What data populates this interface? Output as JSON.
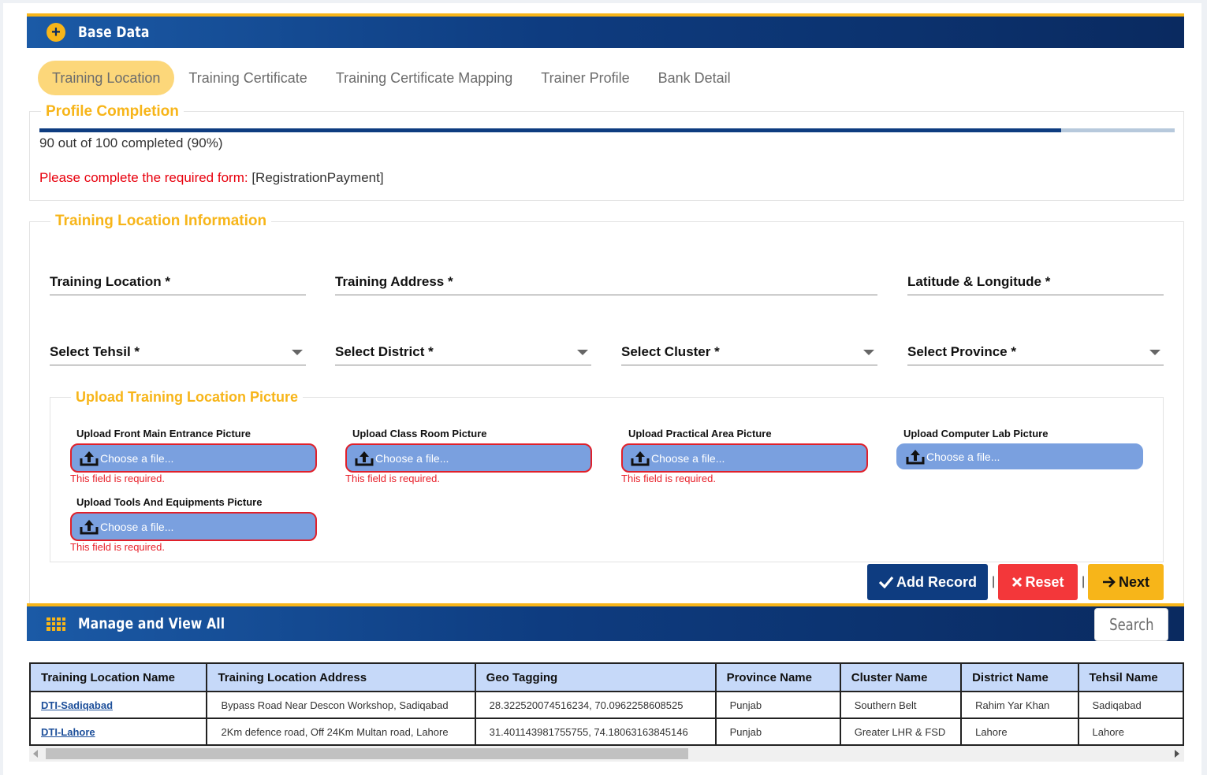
{
  "base_header": {
    "title": "Base Data"
  },
  "tabs": [
    {
      "label": "Training Location",
      "active": true
    },
    {
      "label": "Training Certificate"
    },
    {
      "label": "Training Certificate Mapping"
    },
    {
      "label": "Trainer Profile"
    },
    {
      "label": "Bank Detail"
    }
  ],
  "profile": {
    "legend": "Profile Completion",
    "progress_percent": 90,
    "progress_text": "90 out of 100 completed (90%)",
    "required_prefix": "Please complete the required form:",
    "required_forms": "[RegistrationPayment]"
  },
  "location_info": {
    "legend": "Training Location Information",
    "fields": {
      "training_location": "Training Location *",
      "training_address": "Training Address *",
      "lat_long": "Latitude & Longitude *",
      "tehsil": "Select Tehsil *",
      "district": "Select District *",
      "cluster": "Select Cluster *",
      "province": "Select Province *"
    }
  },
  "upload": {
    "legend": "Upload Training Location Picture",
    "choose_text": "Choose a file...",
    "error_text": "This field is required.",
    "items": {
      "front": "Upload Front Main Entrance Picture",
      "classroom": "Upload Class Room Picture",
      "practical": "Upload Practical Area Picture",
      "computer_lab": "Upload Computer Lab Picture",
      "tools": "Upload Tools And Equipments Picture"
    }
  },
  "actions": {
    "add_record": "Add Record",
    "reset": "Reset",
    "next": "Next",
    "separator": "|"
  },
  "manage_header": {
    "title": "Manage and View All",
    "search_label": "Search"
  },
  "table": {
    "columns": [
      "Training Location Name",
      "Training Location Address",
      "Geo Tagging",
      "Province Name",
      "Cluster Name",
      "District Name",
      "Tehsil Name"
    ],
    "rows": [
      [
        "DTI-Sadiqabad",
        "Bypass Road Near Descon Workshop, Sadiqabad",
        "28.322520074516234, 70.0962258608525",
        "Punjab",
        "Southern Belt",
        "Rahim Yar Khan",
        "Sadiqabad"
      ],
      [
        "DTI-Lahore",
        "2Km defence road, Off 24Km Multan road, Lahore",
        "31.401143981755755, 74.18063163845146",
        "Punjab",
        "Greater LHR & FSD",
        "Lahore",
        "Lahore"
      ]
    ]
  },
  "colors": {
    "brand_navy": "#0e3c80",
    "accent_yellow": "#f7b519",
    "error_red": "#e8202a",
    "upload_blue": "#7aa0df",
    "add_button": "#0e3c80",
    "reset_button": "#f3373a",
    "next_button": "#f7b519"
  },
  "icons": [
    "plus-icon",
    "grid-icon",
    "upload-icon",
    "check-icon",
    "close-icon",
    "arrow-right-icon",
    "caret-down-icon"
  ]
}
